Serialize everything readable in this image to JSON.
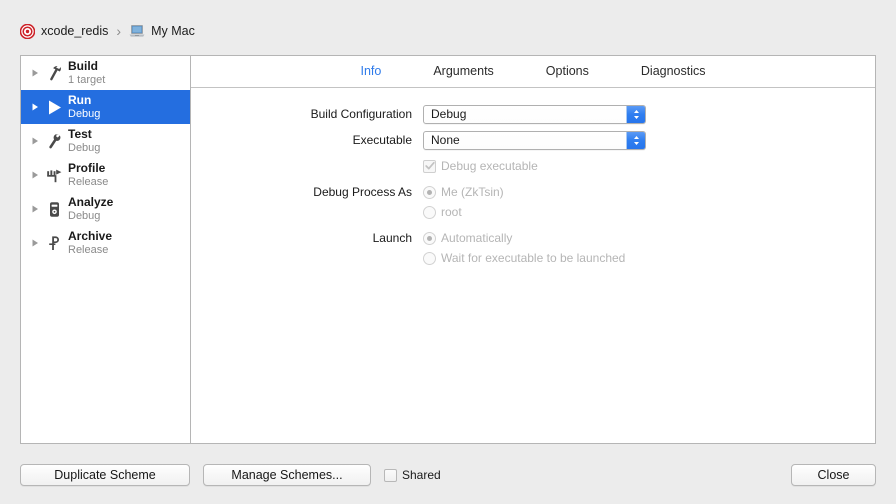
{
  "breadcrumb": {
    "scheme_icon": "scheme-target-icon",
    "scheme_name": "xcode_redis",
    "separator": "›",
    "destination_icon": "my-mac-icon",
    "destination_name": "My Mac"
  },
  "sidebar": {
    "items": [
      {
        "title": "Build",
        "subtitle": "1 target",
        "icon": "hammer-icon",
        "selected": false
      },
      {
        "title": "Run",
        "subtitle": "Debug",
        "icon": "play-icon",
        "selected": true
      },
      {
        "title": "Test",
        "subtitle": "Debug",
        "icon": "wrench-icon",
        "selected": false
      },
      {
        "title": "Profile",
        "subtitle": "Release",
        "icon": "speedometer-icon",
        "selected": false
      },
      {
        "title": "Analyze",
        "subtitle": "Debug",
        "icon": "device-icon",
        "selected": false
      },
      {
        "title": "Archive",
        "subtitle": "Release",
        "icon": "archive-icon",
        "selected": false
      }
    ]
  },
  "tabs": [
    {
      "label": "Info",
      "active": true
    },
    {
      "label": "Arguments",
      "active": false
    },
    {
      "label": "Options",
      "active": false
    },
    {
      "label": "Diagnostics",
      "active": false
    }
  ],
  "form": {
    "build_configuration": {
      "label": "Build Configuration",
      "value": "Debug"
    },
    "executable": {
      "label": "Executable",
      "value": "None"
    },
    "debug_executable": {
      "label": "Debug executable",
      "checked": true,
      "enabled": false
    },
    "debug_process_as": {
      "label": "Debug Process As",
      "options": [
        {
          "label": "Me (ZkTsin)",
          "selected": true
        },
        {
          "label": "root",
          "selected": false
        }
      ]
    },
    "launch": {
      "label": "Launch",
      "options": [
        {
          "label": "Automatically",
          "selected": true
        },
        {
          "label": "Wait for executable to be launched",
          "selected": false
        }
      ]
    }
  },
  "bottom_bar": {
    "duplicate_scheme": "Duplicate Scheme",
    "manage_schemes": "Manage Schemes...",
    "shared_label": "Shared",
    "shared_checked": false,
    "close": "Close"
  },
  "colors": {
    "accent_blue": "#246ee0",
    "tab_active": "#2f7bea",
    "scheme_icon_red": "#cc2127",
    "window_bg": "#ececec",
    "panel_bg": "#ffffff",
    "disabled_text": "#b5b5b5"
  }
}
